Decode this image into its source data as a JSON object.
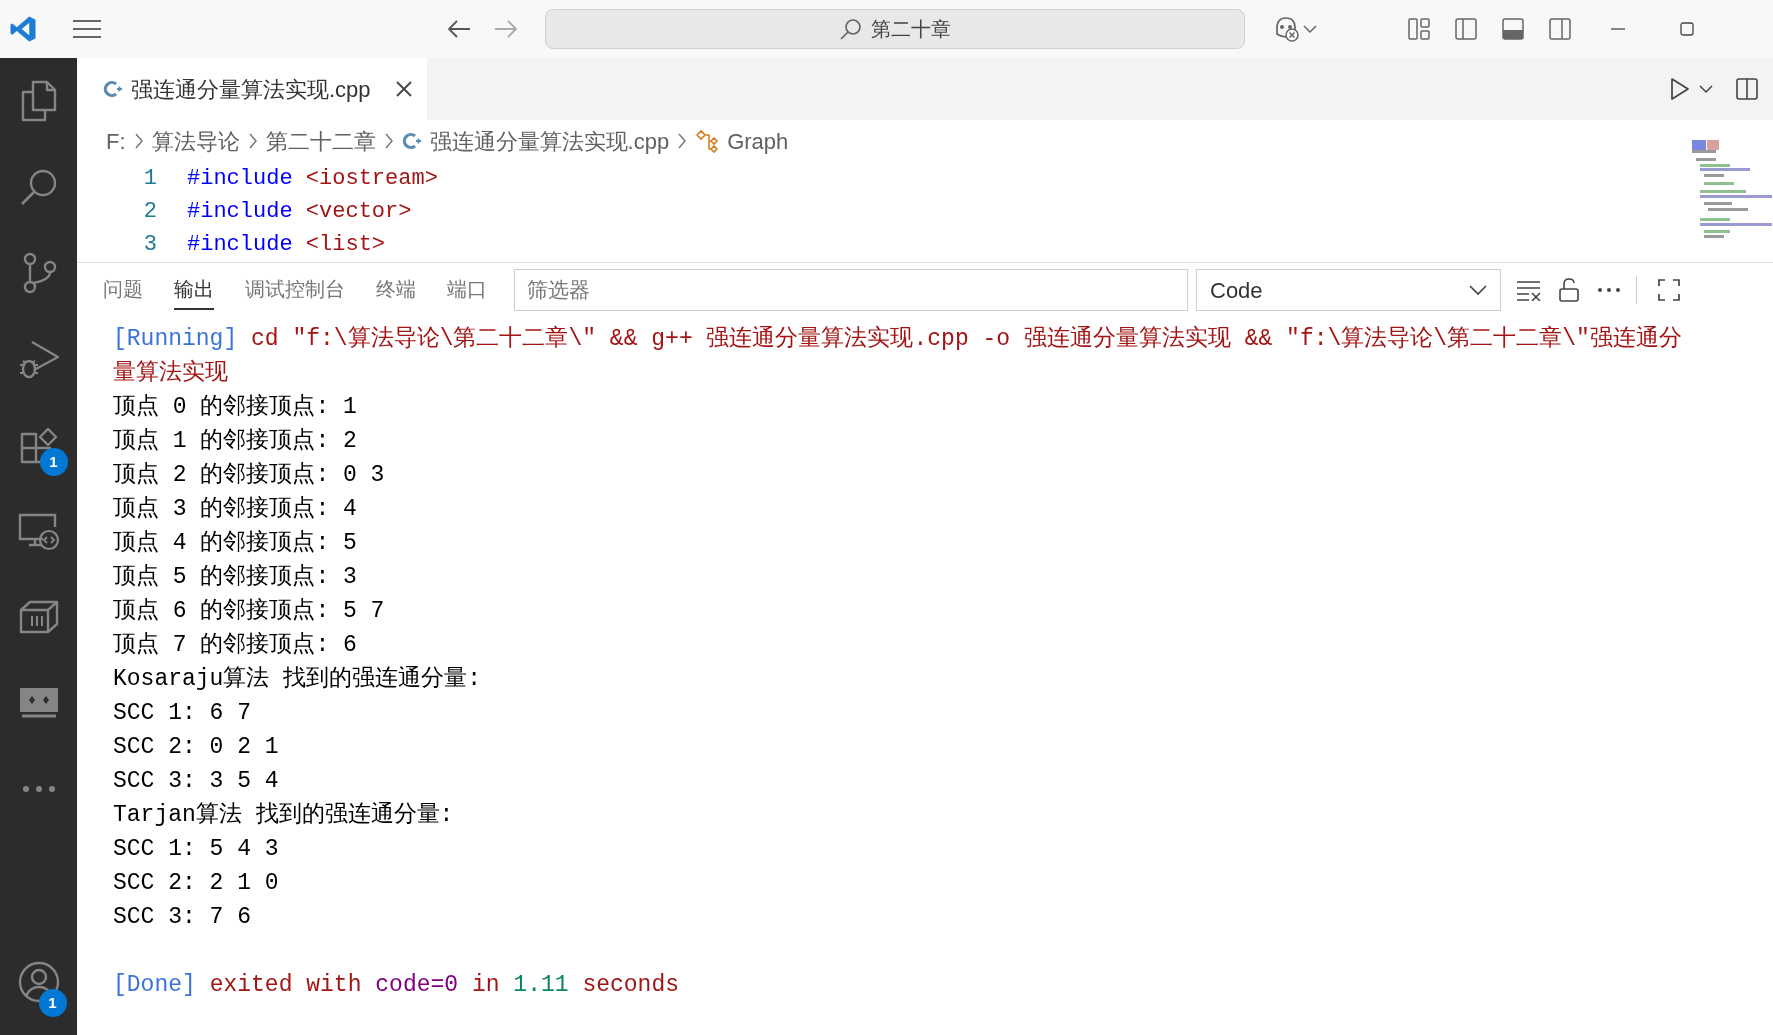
{
  "title_bar": {
    "search": "第二十章"
  },
  "activity_bar": {
    "extensions_badge": "1",
    "accounts_badge": "1"
  },
  "tabs": [
    {
      "label": "强连通分量算法实现.cpp",
      "selected": true
    }
  ],
  "breadcrumb": [
    {
      "kind": "folder",
      "label": "F:"
    },
    {
      "kind": "folder",
      "label": "算法导论"
    },
    {
      "kind": "folder",
      "label": "第二十二章"
    },
    {
      "kind": "file",
      "label": "强连通分量算法实现.cpp"
    },
    {
      "kind": "symbol",
      "label": "Graph"
    }
  ],
  "editor": {
    "lines": [
      {
        "number": "1",
        "directive": "#include",
        "header": "<iostream>"
      },
      {
        "number": "2",
        "directive": "#include",
        "header": "<vector>"
      },
      {
        "number": "3",
        "directive": "#include",
        "header": "<list>"
      }
    ]
  },
  "panel": {
    "tabs": [
      {
        "label": "问题",
        "selected": false
      },
      {
        "label": "输出",
        "selected": true
      },
      {
        "label": "调试控制台",
        "selected": false
      },
      {
        "label": "终端",
        "selected": false
      },
      {
        "label": "端口",
        "selected": false
      }
    ],
    "filter": {
      "placeholder": "筛选器"
    },
    "channel": "Code",
    "output": [
      {
        "segments": [
          {
            "kind": "tag",
            "text": "[Running]"
          },
          {
            "kind": "message",
            "text": "cd \"f:\\算法导论\\第二十二章\\\" && g++ 强连通分量算法实现.cpp -o 强连通分量算法实现 && \"f:\\算法导论\\第二十二章\\\"强连通分量算法实现"
          }
        ]
      },
      {
        "segments": [
          {
            "kind": "plain",
            "text": "顶点 0 的邻接顶点: 1"
          }
        ]
      },
      {
        "segments": [
          {
            "kind": "plain",
            "text": "顶点 1 的邻接顶点: 2"
          }
        ]
      },
      {
        "segments": [
          {
            "kind": "plain",
            "text": "顶点 2 的邻接顶点: 0 3"
          }
        ]
      },
      {
        "segments": [
          {
            "kind": "plain",
            "text": "顶点 3 的邻接顶点: 4"
          }
        ]
      },
      {
        "segments": [
          {
            "kind": "plain",
            "text": "顶点 4 的邻接顶点: 5"
          }
        ]
      },
      {
        "segments": [
          {
            "kind": "plain",
            "text": "顶点 5 的邻接顶点: 3"
          }
        ]
      },
      {
        "segments": [
          {
            "kind": "plain",
            "text": "顶点 6 的邻接顶点: 5 7"
          }
        ]
      },
      {
        "segments": [
          {
            "kind": "plain",
            "text": "顶点 7 的邻接顶点: 6"
          }
        ]
      },
      {
        "segments": [
          {
            "kind": "plain",
            "text": "Kosaraju算法 找到的强连通分量:"
          }
        ]
      },
      {
        "segments": [
          {
            "kind": "plain",
            "text": "SCC 1: 6 7"
          }
        ]
      },
      {
        "segments": [
          {
            "kind": "plain",
            "text": "SCC 2: 0 2 1"
          }
        ]
      },
      {
        "segments": [
          {
            "kind": "plain",
            "text": "SCC 3: 3 5 4"
          }
        ]
      },
      {
        "segments": [
          {
            "kind": "plain",
            "text": "Tarjan算法 找到的强连通分量:"
          }
        ]
      },
      {
        "segments": [
          {
            "kind": "plain",
            "text": "SCC 1: 5 4 3"
          }
        ]
      },
      {
        "segments": [
          {
            "kind": "plain",
            "text": "SCC 2: 2 1 0"
          }
        ]
      },
      {
        "segments": [
          {
            "kind": "plain",
            "text": "SCC 3: 7 6"
          }
        ]
      },
      {
        "segments": [
          {
            "kind": "tag",
            "text": "[Done]"
          },
          {
            "kind": "message",
            "text": "exited with"
          },
          {
            "kind": "code",
            "text": "code=0"
          },
          {
            "kind": "message",
            "text": "in"
          },
          {
            "kind": "time",
            "text": "1.11"
          },
          {
            "kind": "message",
            "text": "seconds"
          }
        ]
      }
    ]
  }
}
